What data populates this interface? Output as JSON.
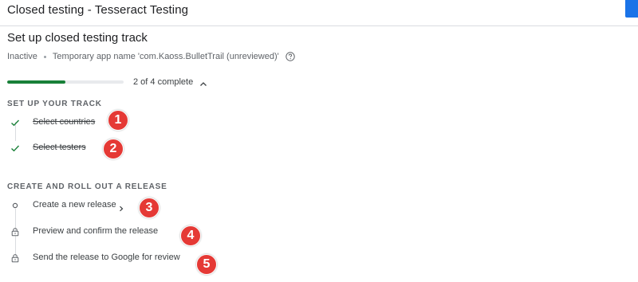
{
  "window": {
    "title": "Closed testing - Tesseract Testing"
  },
  "page": {
    "heading": "Set up closed testing track",
    "status": "Inactive",
    "app_name_text": "Temporary app name 'com.Kaoss.BulletTrail (unreviewed)'"
  },
  "progress": {
    "label": "2 of 4 complete",
    "fraction": 0.5
  },
  "sections": {
    "setup": {
      "title": "SET UP YOUR TRACK",
      "steps": [
        {
          "label": "Select countries",
          "status": "done",
          "icon": "check-icon"
        },
        {
          "label": "Select testers",
          "status": "done",
          "icon": "check-icon"
        }
      ]
    },
    "release": {
      "title": "CREATE AND ROLL OUT A RELEASE",
      "steps": [
        {
          "label": "Create a new release",
          "status": "current",
          "icon": "circle-icon"
        },
        {
          "label": "Preview and confirm the release",
          "status": "locked",
          "icon": "lock-icon"
        },
        {
          "label": "Send the release to Google for review",
          "status": "locked",
          "icon": "lock-icon"
        }
      ]
    }
  },
  "annotations": [
    "1",
    "2",
    "3",
    "4",
    "5"
  ],
  "colors": {
    "accent_blue": "#1a73e8",
    "progress_green": "#188038",
    "check_green": "#188038",
    "badge_red": "#e53935"
  }
}
